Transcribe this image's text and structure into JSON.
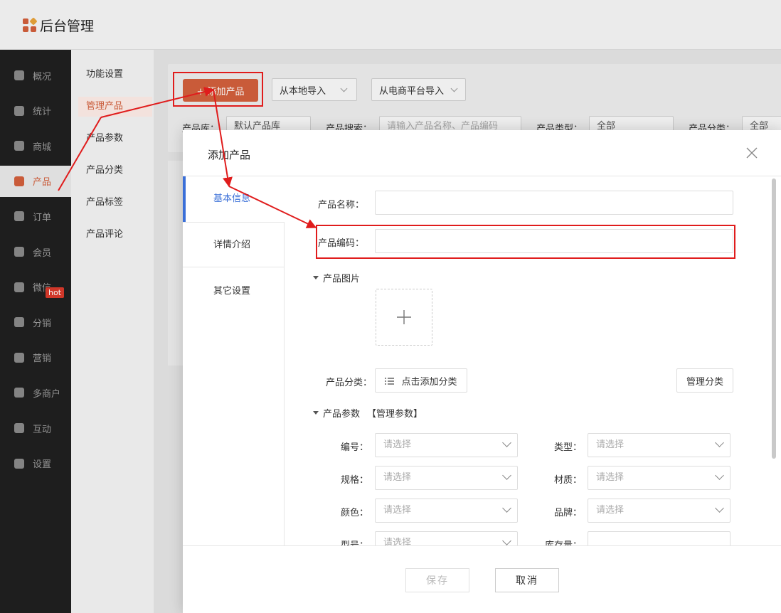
{
  "app": {
    "title": "后台管理"
  },
  "colors": {
    "accent": "#d25f3c",
    "tab_active": "#3a6fd8",
    "annotation_red": "#e01c1c",
    "hot_badge": "#d93a2b"
  },
  "sidebar": {
    "items": [
      {
        "label": "概况",
        "icon": "layers-icon"
      },
      {
        "label": "统计",
        "icon": "chart-icon"
      },
      {
        "label": "商城",
        "icon": "store-icon"
      },
      {
        "label": "产品",
        "icon": "grid-icon",
        "active": true
      },
      {
        "label": "订单",
        "icon": "clipboard-icon"
      },
      {
        "label": "会员",
        "icon": "crown-icon"
      },
      {
        "label": "微信",
        "icon": "wechat-icon"
      },
      {
        "label": "分销",
        "icon": "users-icon"
      },
      {
        "label": "营销",
        "icon": "flag-icon",
        "badge": "hot"
      },
      {
        "label": "多商户",
        "icon": "shop-plus-icon"
      },
      {
        "label": "互动",
        "icon": "interact-icon"
      },
      {
        "label": "设置",
        "icon": "gear-icon"
      }
    ]
  },
  "subnav": {
    "items": [
      {
        "label": "功能设置"
      },
      {
        "label": "管理产品",
        "active": true
      },
      {
        "label": "产品参数"
      },
      {
        "label": "产品分类"
      },
      {
        "label": "产品标签"
      },
      {
        "label": "产品评论"
      }
    ]
  },
  "toolbar": {
    "add_label": "+ 添加产品",
    "import_local": "从本地导入",
    "import_ecom": "从电商平台导入"
  },
  "filters": {
    "library_label": "产品库：",
    "library_value": "默认产品库",
    "search_label": "产品搜索：",
    "search_placeholder": "请输入产品名称、产品编码",
    "type_label": "产品类型：",
    "type_value": "全部",
    "category_label": "产品分类：",
    "category_value": "全部"
  },
  "modal": {
    "title": "添加产品",
    "tabs": [
      "基本信息",
      "详情介绍",
      "其它设置"
    ],
    "fields": {
      "name_label": "产品名称：",
      "code_label": "产品编码：",
      "image_section": "产品图片",
      "category_label": "产品分类：",
      "add_category": "点击添加分类",
      "manage_category": "管理分类",
      "params_section": "产品参数",
      "manage_params": "【管理参数】"
    },
    "params": [
      {
        "label": "编号：",
        "placeholder": "请选择"
      },
      {
        "label": "类型：",
        "placeholder": "请选择"
      },
      {
        "label": "规格：",
        "placeholder": "请选择"
      },
      {
        "label": "材质：",
        "placeholder": "请选择"
      },
      {
        "label": "颜色：",
        "placeholder": "请选择"
      },
      {
        "label": "品牌：",
        "placeholder": "请选择"
      },
      {
        "label": "型号：",
        "placeholder": "请选择"
      },
      {
        "label": "库存量：",
        "placeholder": ""
      }
    ],
    "save": "保存",
    "cancel": "取消"
  }
}
